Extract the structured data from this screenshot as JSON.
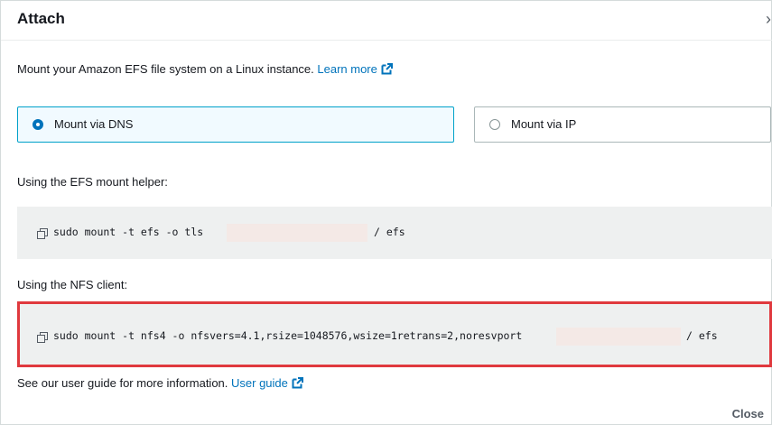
{
  "modal": {
    "title": "Attach",
    "close_glyph": "›"
  },
  "intro": {
    "text": "Mount your Amazon EFS file system on a Linux instance. ",
    "link": "Learn more"
  },
  "mount_options": [
    {
      "label": "Mount via DNS",
      "selected": true
    },
    {
      "label": "Mount via IP",
      "selected": false
    }
  ],
  "helper": {
    "label": "Using the EFS mount helper:",
    "cmd_prefix": "sudo mount -t efs -o tls",
    "cmd_suffix": "/ efs"
  },
  "nfs": {
    "label": "Using the NFS client:",
    "cmd_prefix": "sudo mount -t nfs4 -o nfsvers=4.1,rsize=1048576,wsize=1retrans=2,noresvport",
    "cmd_suffix": "/ efs"
  },
  "footer": {
    "text": "See our user guide for more information. ",
    "link": "User guide",
    "close_button": "Close"
  },
  "colors": {
    "link": "#0073bb",
    "selected_border": "#00a1c9",
    "highlight_border": "#e0393e",
    "code_bg": "#eef0f0"
  },
  "icons": [
    "external-link-icon",
    "copy-icon",
    "radio-selected-icon",
    "radio-unselected-icon"
  ]
}
